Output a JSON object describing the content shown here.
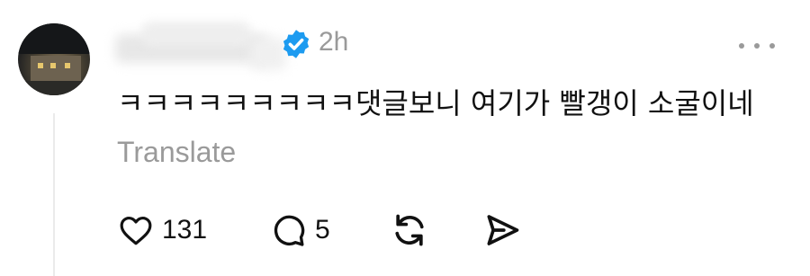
{
  "post": {
    "timestamp": "2h",
    "text": "ㅋㅋㅋㅋㅋㅋㅋㅋㅋ댓글보니 여기가 빨갱이 소굴이네",
    "translate_label": "Translate",
    "verified": true
  },
  "actions": {
    "likes": "131",
    "replies": "5"
  },
  "icons": {
    "like": "heart-icon",
    "reply": "comment-icon",
    "repost": "repost-icon",
    "share": "send-icon",
    "more": "more-dots-icon",
    "verified": "verified-badge-icon"
  },
  "colors": {
    "verified_blue": "#1d9bf0",
    "muted_gray": "#9a9a9a",
    "text": "#111111"
  }
}
